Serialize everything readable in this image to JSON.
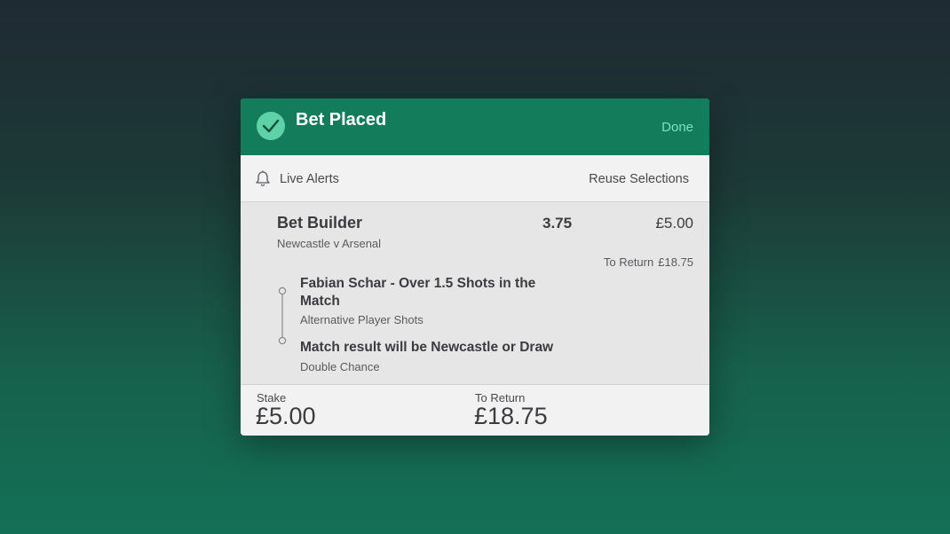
{
  "header": {
    "title": "Bet Placed",
    "done_label": "Done",
    "icon": "check-circle-icon",
    "color": "#137c5b"
  },
  "alerts_bar": {
    "live_alerts_label": "Live Alerts",
    "reuse_label": "Reuse Selections",
    "icon": "bell-icon"
  },
  "bet": {
    "title": "Bet Builder",
    "odds": "3.75",
    "stake": "£5.00",
    "match": "Newcastle v Arsenal",
    "to_return_label": "To Return",
    "to_return_value": "£18.75",
    "selections": [
      {
        "name": "Fabian Schar - Over 1.5 Shots in the Match",
        "market": "Alternative Player Shots"
      },
      {
        "name": "Match result will be Newcastle or Draw",
        "market": "Double Chance"
      }
    ]
  },
  "footer": {
    "stake_label": "Stake",
    "stake_value": "£5.00",
    "return_label": "To Return",
    "return_value": "£18.75"
  }
}
